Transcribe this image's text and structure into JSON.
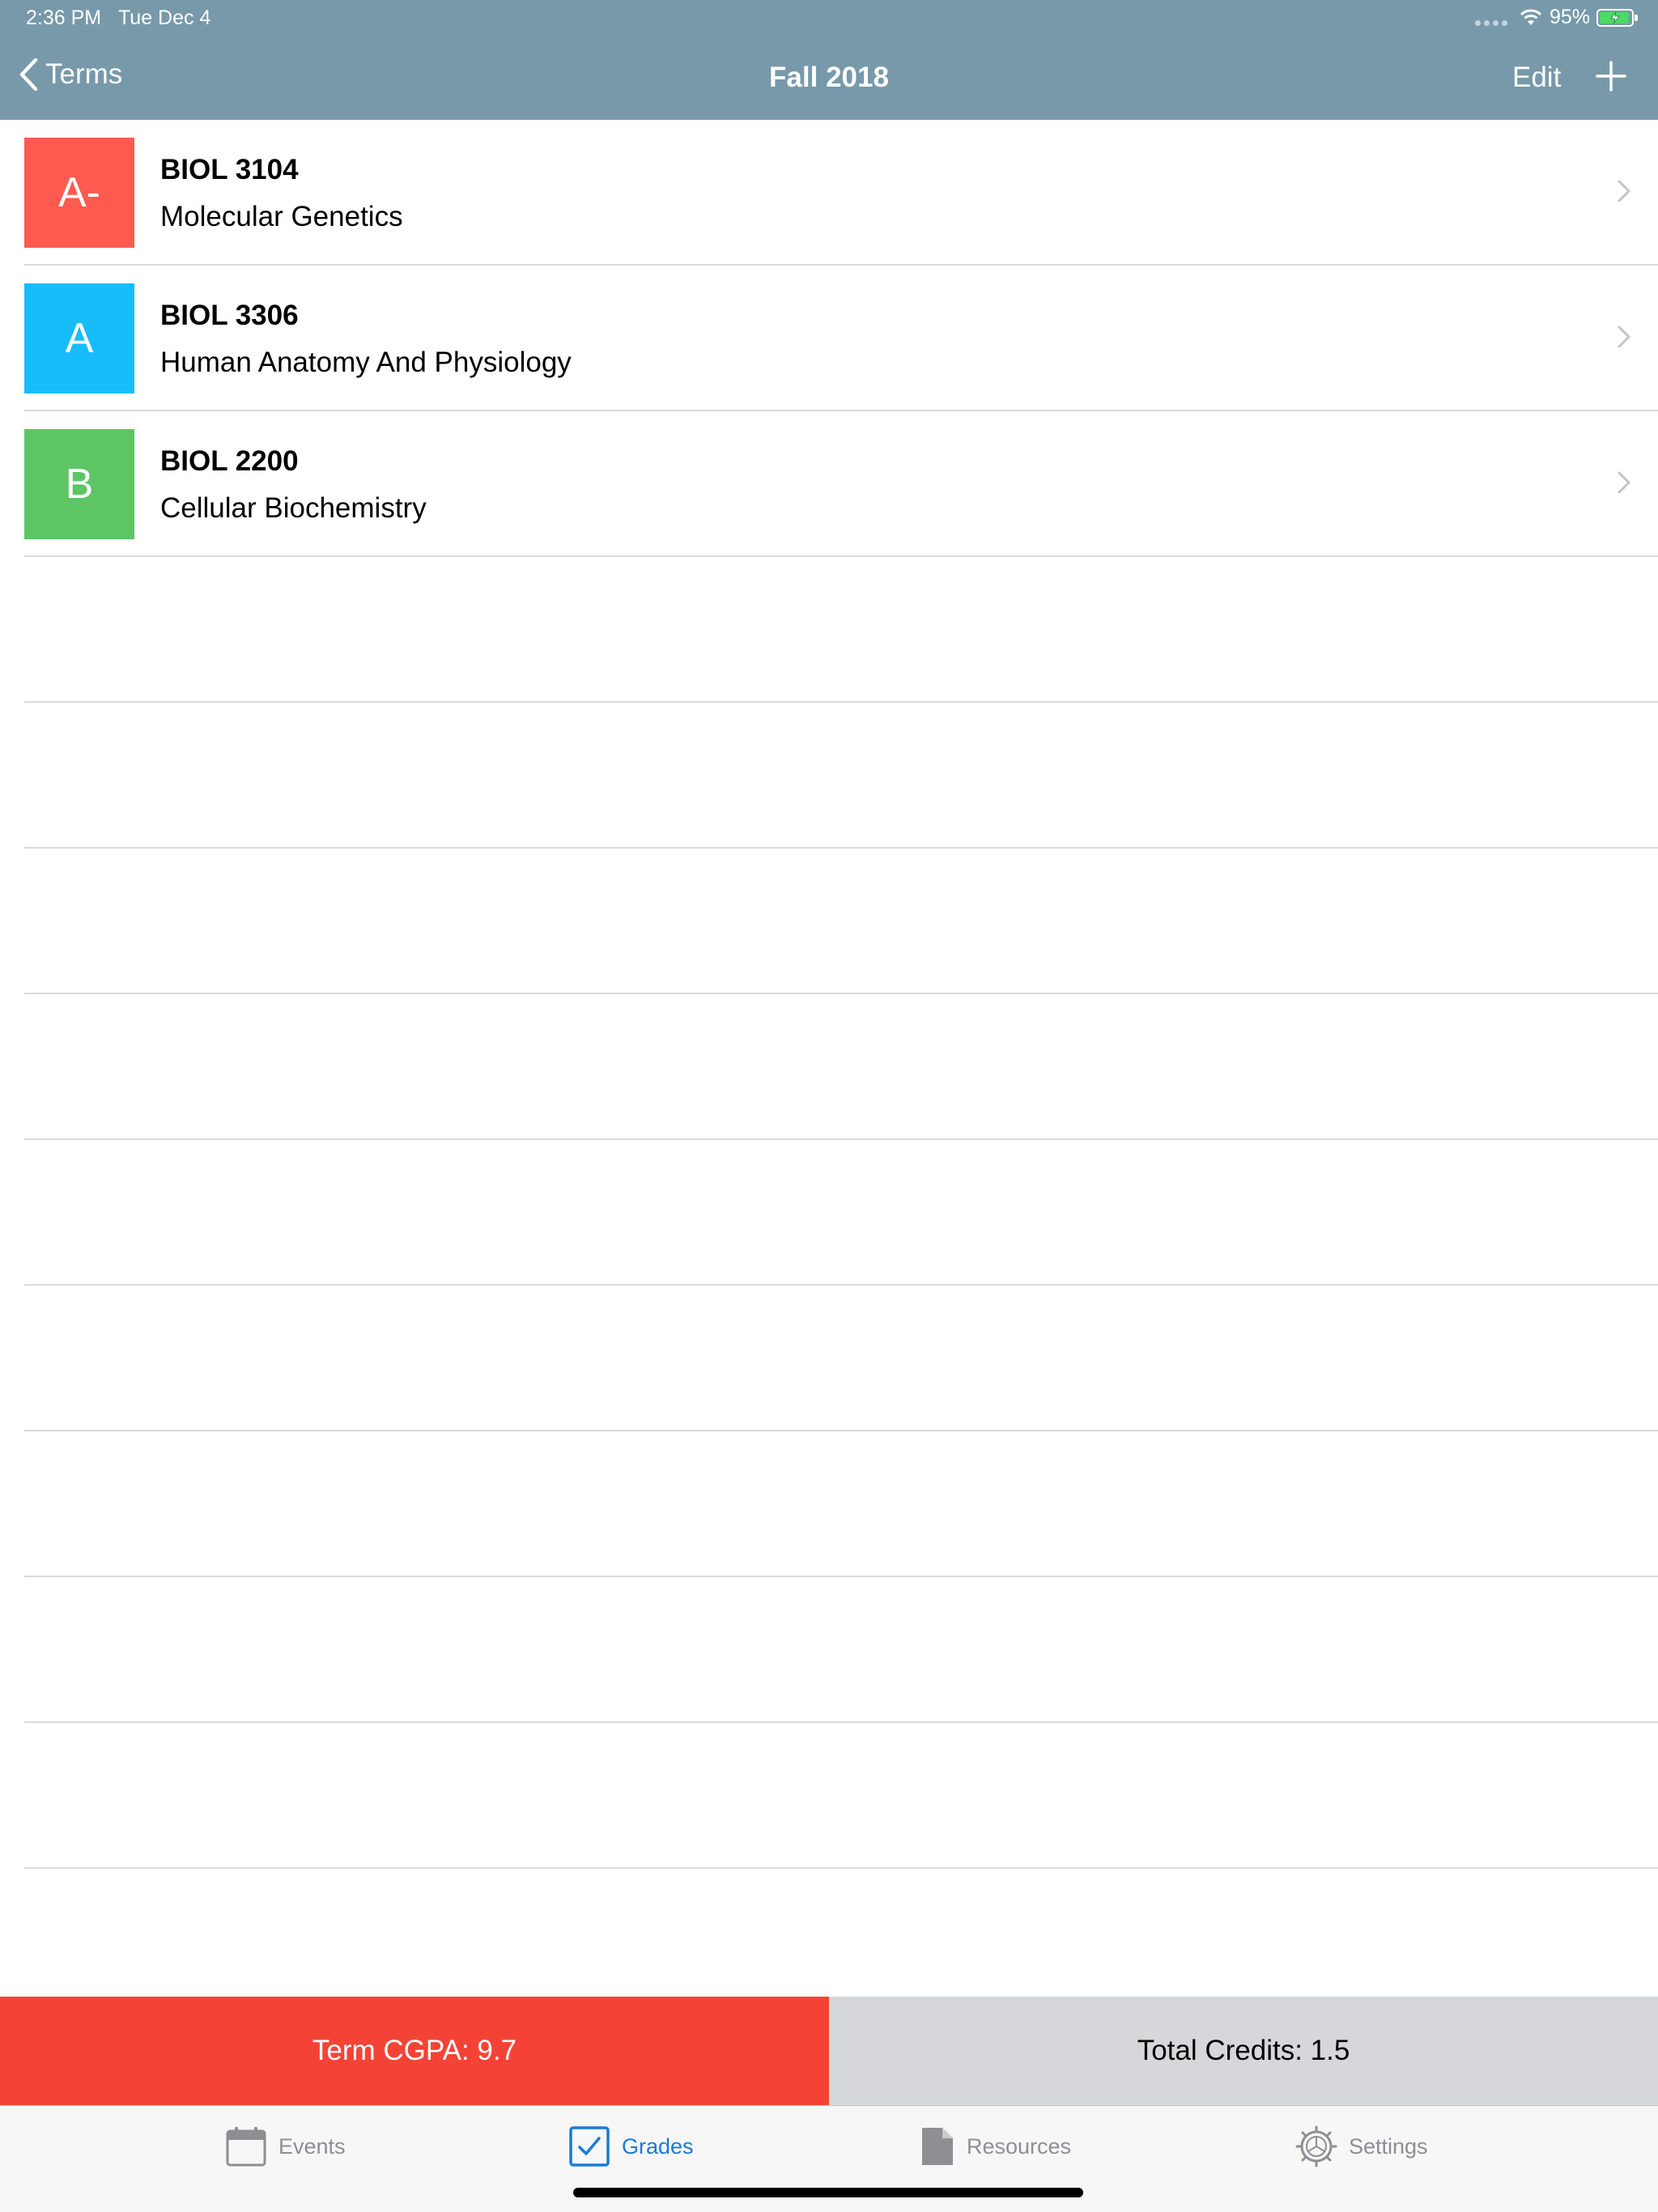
{
  "status_bar": {
    "time": "2:36 PM",
    "date": "Tue Dec 4",
    "battery": "95%"
  },
  "nav": {
    "back_label": "Terms",
    "title": "Fall 2018",
    "edit_label": "Edit",
    "add_icon": "plus-icon"
  },
  "courses": [
    {
      "grade": "A-",
      "code": "BIOL 3104",
      "name": "Molecular Genetics",
      "color": "#fe5a4f"
    },
    {
      "grade": "A",
      "code": "BIOL 3306",
      "name": "Human Anatomy And Physiology",
      "color": "#17bdf9"
    },
    {
      "grade": "B",
      "code": "BIOL 2200",
      "name": "Cellular Biochemistry",
      "color": "#5ec565"
    }
  ],
  "summary": {
    "gpa": "Term CGPA: 9.7",
    "credits": "Total Credits: 1.5",
    "gpa_color": "#f44336",
    "credits_color": "#d5d7db"
  },
  "tabs": [
    {
      "label": "Events",
      "icon": "calendar-icon",
      "active": false
    },
    {
      "label": "Grades",
      "icon": "checkbox-icon",
      "active": true
    },
    {
      "label": "Resources",
      "icon": "document-icon",
      "active": false
    },
    {
      "label": "Settings",
      "icon": "gear-icon",
      "active": false
    }
  ],
  "colors": {
    "nav_bar": "#7799aa",
    "active_tab": "#1a7ad6",
    "inactive_tab": "#8e8e93"
  }
}
